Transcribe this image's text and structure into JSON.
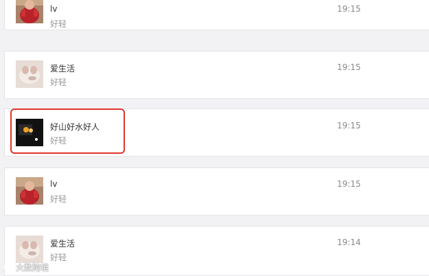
{
  "messages": [
    {
      "name": "lv",
      "preview": "好轻",
      "time": "19:15",
      "avatar": "red-doll"
    },
    {
      "name": "爱生活",
      "preview": "好轻",
      "time": "19:15",
      "avatar": "white-dog"
    },
    {
      "name": "好山好水好人",
      "preview": "好轻",
      "time": "19:15",
      "avatar": "dark-night"
    },
    {
      "name": "lv",
      "preview": "好轻",
      "time": "19:15",
      "avatar": "red-doll"
    },
    {
      "name": "爱生活",
      "preview": "好轻",
      "time": "19:14",
      "avatar": "white-dog"
    }
  ],
  "highlight": {
    "target_index": 2,
    "color": "#e0342b"
  },
  "watermark": {
    "text": "大数跨境"
  }
}
